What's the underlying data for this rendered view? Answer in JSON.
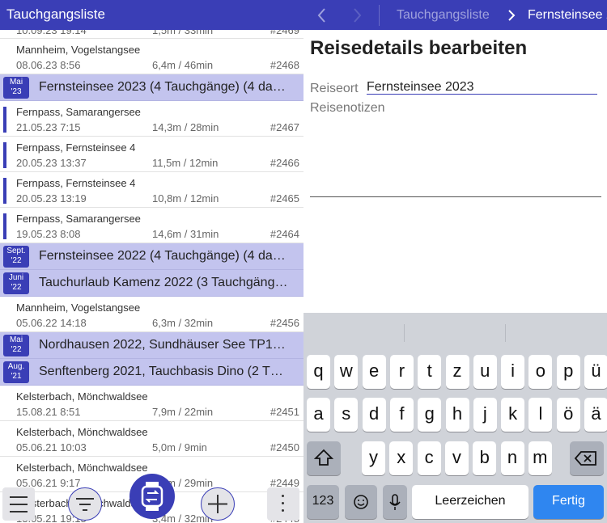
{
  "left_pane": {
    "title": "Tauchgangsliste",
    "partial_top_row": {
      "date": "10.09.23 19:14",
      "depth": "1,5m / 33min",
      "num": "#2469"
    },
    "rows": [
      {
        "kind": "dive",
        "location": "Mannheim, Vogelstangsee",
        "date": "08.06.23 8:56",
        "depth": "6,4m / 46min",
        "num": "#2468",
        "marker": false
      },
      {
        "kind": "trip",
        "badge_month": "Mai",
        "badge_year": "'23",
        "title": "Fernsteinsee 2023 (4 Tauchgänge) (4 da…"
      },
      {
        "kind": "dive",
        "location": "Fernpass, Samarangersee",
        "date": "21.05.23 7:15",
        "depth": "14,3m / 28min",
        "num": "#2467",
        "marker": true
      },
      {
        "kind": "dive",
        "location": "Fernpass, Fernsteinsee 4",
        "date": "20.05.23 13:37",
        "depth": "11,5m / 12min",
        "num": "#2466",
        "marker": true
      },
      {
        "kind": "dive",
        "location": "Fernpass, Fernsteinsee 4",
        "date": "20.05.23 13:19",
        "depth": "10,8m / 12min",
        "num": "#2465",
        "marker": true
      },
      {
        "kind": "dive",
        "location": "Fernpass, Samarangersee",
        "date": "19.05.23 8:08",
        "depth": "14,6m / 31min",
        "num": "#2464",
        "marker": true
      },
      {
        "kind": "trip",
        "badge_month": "Sept.",
        "badge_year": "'22",
        "title": "Fernsteinsee 2022 (4 Tauchgänge) (4 da…"
      },
      {
        "kind": "trip",
        "badge_month": "Juni",
        "badge_year": "'22",
        "title": "Tauchurlaub Kamenz 2022 (3 Tauchgäng…"
      },
      {
        "kind": "dive",
        "location": "Mannheim, Vogelstangsee",
        "date": "05.06.22 14:18",
        "depth": "6,3m / 32min",
        "num": "#2456",
        "marker": false
      },
      {
        "kind": "trip",
        "badge_month": "Mai",
        "badge_year": "'22",
        "title": "Nordhausen 2022, Sundhäuser See TP1…"
      },
      {
        "kind": "trip",
        "badge_month": "Aug.",
        "badge_year": "'21",
        "title": "Senftenberg 2021, Tauchbasis Dino (2 T…"
      },
      {
        "kind": "dive",
        "location": "Kelsterbach, Mönchwaldsee",
        "date": "15.08.21 8:51",
        "depth": "7,9m / 22min",
        "num": "#2451",
        "marker": false
      },
      {
        "kind": "dive",
        "location": "Kelsterbach, Mönchwaldsee",
        "date": "05.06.21 10:03",
        "depth": "5,0m / 9min",
        "num": "#2450",
        "marker": false
      },
      {
        "kind": "dive",
        "location": "Kelsterbach, Mönchwaldsee",
        "date": "05.06.21 9:17",
        "depth": "2,9m / 29min",
        "num": "#2449",
        "marker": false
      },
      {
        "kind": "dive",
        "location": "Kelsterbach, Mönchwaldsee",
        "date": "13.05.21 19:15",
        "depth": "3,4m / 32min",
        "num": "#2448",
        "marker": false
      }
    ],
    "toolbar": {
      "menu_icon": "hamburger-menu-icon",
      "filter_icon": "filter-icon",
      "sync_icon": "watch-sync-icon",
      "add_icon": "plus-icon",
      "more_icon": "vertical-dots-icon"
    }
  },
  "right_pane": {
    "breadcrumb_parent": "Tauchgangsliste",
    "breadcrumb_current": "Fernsteinsee 2023",
    "heading": "Reisedetails bearbeiten",
    "reiseort_label": "Reiseort",
    "reiseort_value": "Fernsteinsee 2023",
    "notes_label": "Reisenotizen",
    "notes_value": ""
  },
  "keyboard": {
    "row1": [
      "q",
      "w",
      "e",
      "r",
      "t",
      "z",
      "u",
      "i",
      "o",
      "p",
      "ü"
    ],
    "row2": [
      "a",
      "s",
      "d",
      "f",
      "g",
      "h",
      "j",
      "k",
      "l",
      "ö",
      "ä"
    ],
    "row3": [
      "y",
      "x",
      "c",
      "v",
      "b",
      "n",
      "m"
    ],
    "numbers_key": "123",
    "space_key": "Leerzeichen",
    "done_key": "Fertig"
  },
  "colors": {
    "accent": "#3a3eb6",
    "trip_row_bg": "#c3c4ee",
    "keyboard_bg": "#d0d3d9",
    "done_key": "#2f86f0"
  }
}
